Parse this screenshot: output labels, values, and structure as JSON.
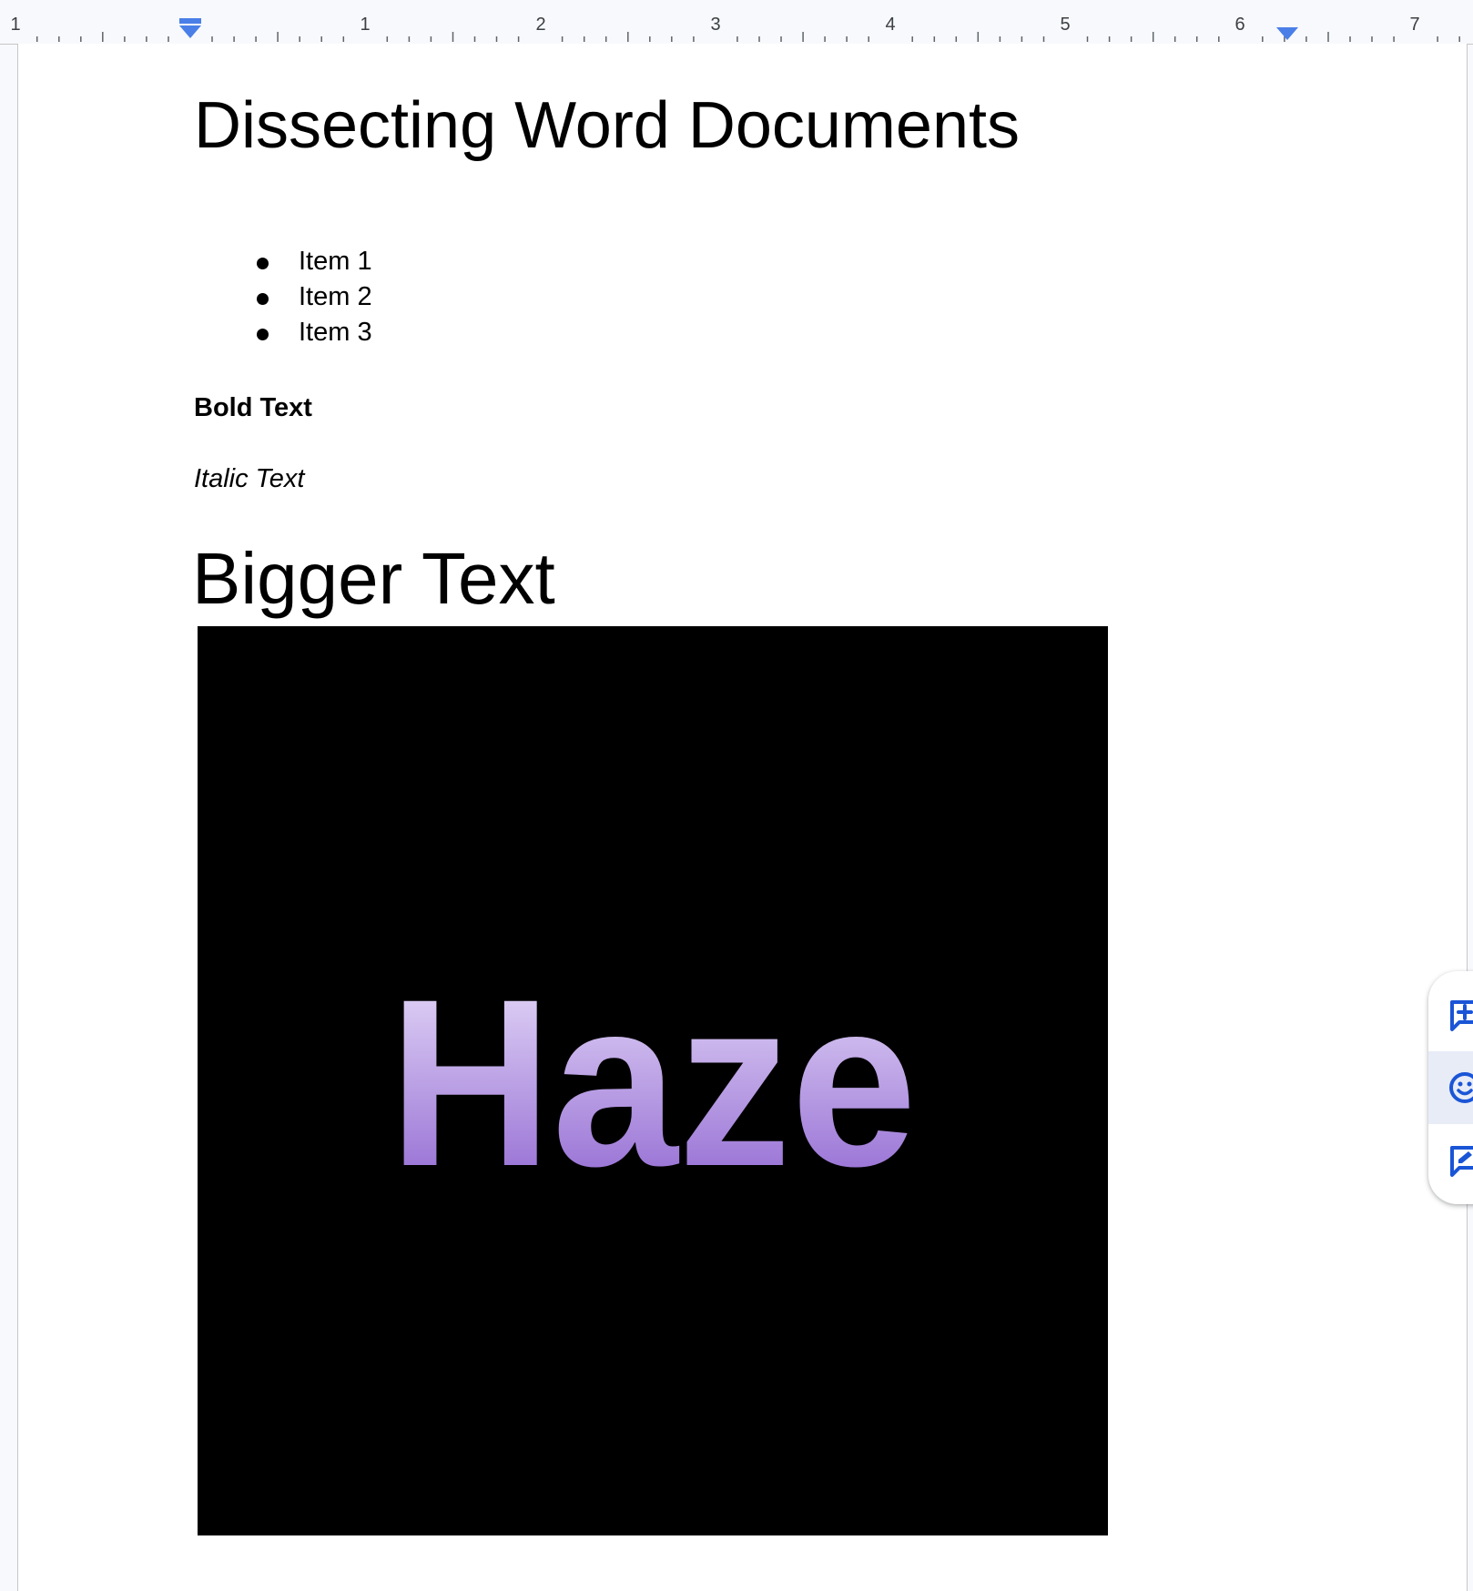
{
  "ruler": {
    "labels": [
      "1",
      "1",
      "2",
      "3",
      "4",
      "5",
      "6",
      "7"
    ]
  },
  "document": {
    "title": "Dissecting Word Documents",
    "list_items": [
      "Item 1",
      "Item 2",
      "Item 3"
    ],
    "bold_text": "Bold Text",
    "italic_text": "Italic Text",
    "bigger_text": "Bigger Text",
    "image": {
      "text": "Haze",
      "background_color": "#000000",
      "gradient_top": "#ece3fb",
      "gradient_bottom": "#8b60cf"
    }
  },
  "side_panel": {
    "buttons": [
      "add-comment-icon",
      "emoji-reaction-icon",
      "suggest-edits-icon"
    ],
    "accent_color": "#1a55d6"
  }
}
